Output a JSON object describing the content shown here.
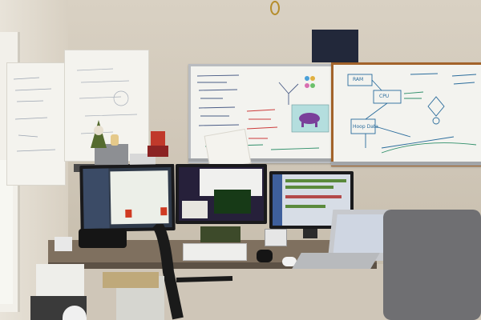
{
  "scene": {
    "room": "home office corner",
    "colors": {
      "wall": "#d9d1c3",
      "whiteboard": "#f3f3ef",
      "whiteboard_frame": "#b9bcc0",
      "whiteboard_right_frame": "#a2632a",
      "desk": "#7f705f",
      "screen_blue": "#4a6fb0",
      "screen_green": "#3a8a3a",
      "marker_red": "#cc3b3b",
      "marker_green": "#2f8f6a",
      "purple_drawing": "#7a3f9a"
    }
  },
  "right_whiteboard": {
    "labels": [
      "RAM",
      "CPU",
      "Hoop Data"
    ]
  },
  "icons": [
    "whiteboard",
    "monitor",
    "laptop",
    "keyboard",
    "mouse",
    "chair",
    "desk",
    "printer",
    "speaker",
    "window",
    "figurine"
  ]
}
